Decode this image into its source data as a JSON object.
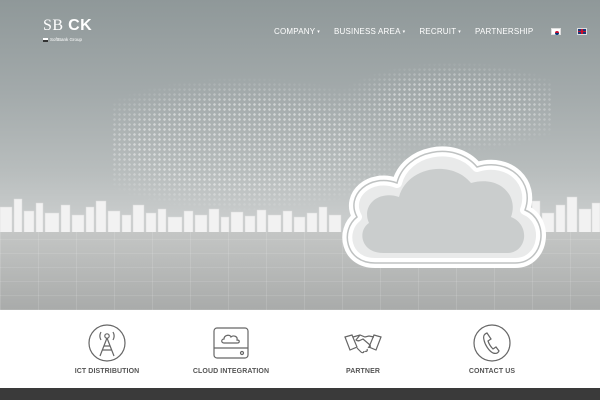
{
  "header": {
    "logo_main": "SB",
    "logo_accent": "CK",
    "logo_sub": "SoftBank Group"
  },
  "nav": {
    "items": [
      {
        "label": "COMPANY",
        "has_dropdown": true
      },
      {
        "label": "BUSINESS AREA",
        "has_dropdown": true
      },
      {
        "label": "RECRUIT",
        "has_dropdown": true
      },
      {
        "label": "PARTNERSHIP",
        "has_dropdown": false
      }
    ],
    "caret": "▾",
    "languages": [
      "korean-flag-icon",
      "uk-flag-icon"
    ]
  },
  "hero": {
    "image": "cloud-city-hero",
    "icons": [
      "world-map-dots",
      "cloud-icon"
    ]
  },
  "services": [
    {
      "label": "ICT DISTRIBUTION",
      "icon": "antenna-tower-icon"
    },
    {
      "label": "CLOUD INTEGRATION",
      "icon": "cloud-drive-icon"
    },
    {
      "label": "PARTNER",
      "icon": "handshake-icon"
    },
    {
      "label": "CONTACT US",
      "icon": "phone-icon"
    }
  ],
  "colors": {
    "nav_text": "#ffffff",
    "service_text": "#555555",
    "icon_stroke": "#666666",
    "footer_bar": "#3a3a3a"
  }
}
